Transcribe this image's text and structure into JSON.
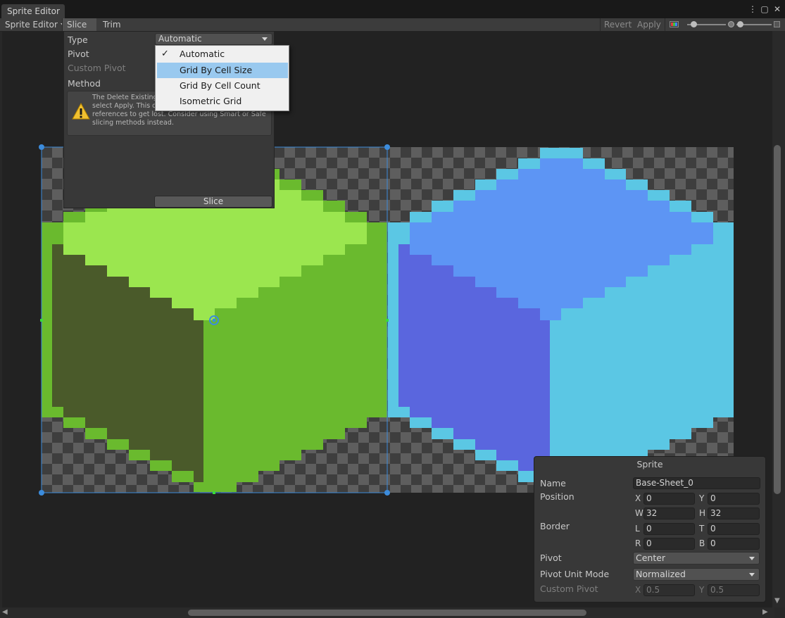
{
  "window": {
    "tab_title": "Sprite Editor",
    "menu_icon": "kebab-menu-icon",
    "maximize_icon": "maximize-icon",
    "close_icon": "close-icon"
  },
  "toolbar": {
    "mode_dropdown": "Sprite Editor",
    "slice_label": "Slice",
    "trim_label": "Trim",
    "revert_label": "Revert",
    "apply_label": "Apply",
    "color_channel_icon": "rgb-channel-icon",
    "alpha_zoom_icon": "zoom-slider-icon"
  },
  "slice_panel": {
    "type_label": "Type",
    "type_value": "Automatic",
    "pivot_label": "Pivot",
    "custom_pivot_label": "Custom Pivot",
    "method_label": "Method",
    "warning_text": "The Delete Existing current Sprites and once you select Apply. This operation could cause the Sprite references to get lost. Consider using Smart or Safe slicing methods instead.",
    "warning_icon": "warning-icon",
    "slice_button": "Slice"
  },
  "type_menu": {
    "items": [
      {
        "label": "Automatic",
        "checked": true,
        "highlighted": false
      },
      {
        "label": "Grid By Cell Size",
        "checked": false,
        "highlighted": true
      },
      {
        "label": "Grid By Cell Count",
        "checked": false,
        "highlighted": false
      },
      {
        "label": "Isometric Grid",
        "checked": false,
        "highlighted": false
      }
    ]
  },
  "sprite_window": {
    "title": "Sprite",
    "name_label": "Name",
    "name_value": "Base-Sheet_0",
    "position_label": "Position",
    "x_label": "X",
    "x_value": "0",
    "y_label": "Y",
    "y_value": "0",
    "w_label": "W",
    "w_value": "32",
    "h_label": "H",
    "h_value": "32",
    "border_label": "Border",
    "l_label": "L",
    "l_value": "0",
    "t_label": "T",
    "t_value": "0",
    "r_label": "R",
    "r_value": "0",
    "b_label": "B",
    "b_value": "0",
    "pivot_label": "Pivot",
    "pivot_value": "Center",
    "pivot_unit_label": "Pivot Unit Mode",
    "pivot_unit_value": "Normalized",
    "custom_pivot_label": "Custom Pivot",
    "cp_x_label": "X",
    "cp_x_value": "0.5",
    "cp_y_label": "Y",
    "cp_y_value": "0.5"
  },
  "colors": {
    "green_light": "#9be64f",
    "green_mid": "#6aba2e",
    "green_dark": "#4a5a2a",
    "blue_light": "#5bc7e4",
    "blue_mid": "#5d95f4",
    "blue_dark": "#5a66de",
    "selection": "#3c8cdc",
    "handle_side": "#3adc3a"
  }
}
